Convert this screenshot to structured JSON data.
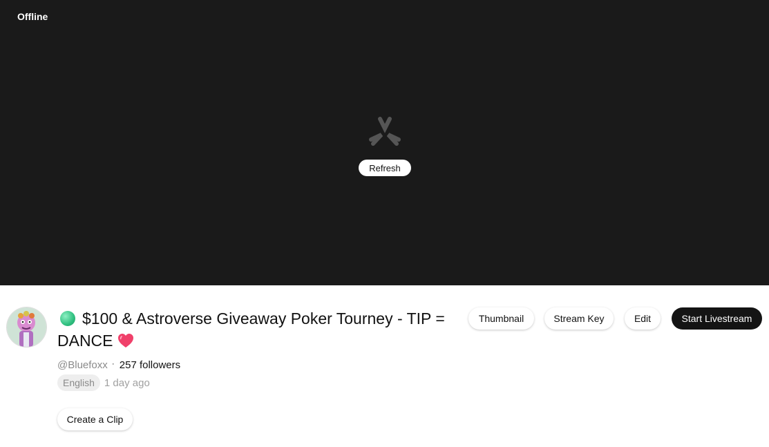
{
  "player": {
    "status_label": "Offline",
    "refresh_label": "Refresh"
  },
  "stream": {
    "title": "$100 & Astroverse Giveaway Poker Tourney - TIP = DANCE",
    "handle": "@Bluefoxx",
    "separator": "·",
    "followers": "257 followers",
    "language": "English",
    "time_ago": "1 day ago"
  },
  "actions": {
    "thumbnail": "Thumbnail",
    "stream_key": "Stream Key",
    "edit": "Edit",
    "start_livestream": "Start Livestream",
    "create_clip": "Create a Clip"
  },
  "colors": {
    "player_bg": "#1a1a1a",
    "status_dot": "#2fbf7f",
    "heart": "#f0406a",
    "primary_button": "#141414"
  },
  "icons": {
    "player_logo": "kick-logo-icon",
    "live_status": "green-circle-icon",
    "title_emoji": "heart-icon"
  }
}
